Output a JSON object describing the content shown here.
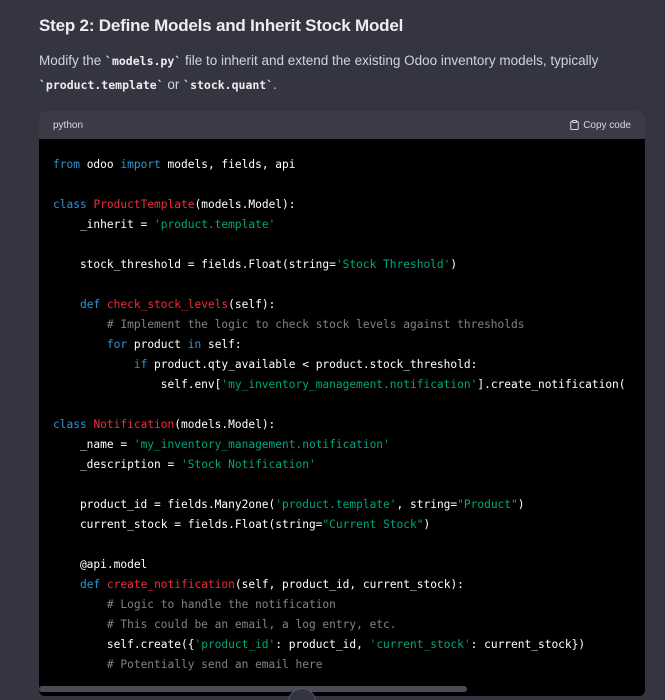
{
  "heading": "Step 2: Define Models and Inherit Stock Model",
  "paragraph": {
    "part1": "Modify the ",
    "code1": "`models.py`",
    "part2": " file to inherit and extend the existing Odoo inventory models, typically ",
    "code2": "`product.template`",
    "part3": " or ",
    "code3": "`stock.quant`",
    "part4": "."
  },
  "code_block": {
    "language": "python",
    "copy_label": "Copy code",
    "copy_icon": "clipboard-icon",
    "lines": [
      [
        [
          "kw",
          "from"
        ],
        [
          "plain",
          " odoo "
        ],
        [
          "kw",
          "import"
        ],
        [
          "plain",
          " models, fields, api"
        ]
      ],
      [],
      [
        [
          "kw",
          "class"
        ],
        [
          "plain",
          " "
        ],
        [
          "cls",
          "ProductTemplate"
        ],
        [
          "plain",
          "(models.Model):"
        ]
      ],
      [
        [
          "plain",
          "    _inherit = "
        ],
        [
          "str",
          "'product.template'"
        ]
      ],
      [],
      [
        [
          "plain",
          "    stock_threshold = fields.Float(string="
        ],
        [
          "str",
          "'Stock Threshold'"
        ],
        [
          "plain",
          ")"
        ]
      ],
      [],
      [
        [
          "plain",
          "    "
        ],
        [
          "kw",
          "def"
        ],
        [
          "plain",
          " "
        ],
        [
          "cls",
          "check_stock_levels"
        ],
        [
          "plain",
          "(self):"
        ]
      ],
      [
        [
          "plain",
          "        "
        ],
        [
          "cmt",
          "# Implement the logic to check stock levels against thresholds"
        ]
      ],
      [
        [
          "plain",
          "        "
        ],
        [
          "kw",
          "for"
        ],
        [
          "plain",
          " product "
        ],
        [
          "kw",
          "in"
        ],
        [
          "plain",
          " self:"
        ]
      ],
      [
        [
          "plain",
          "            "
        ],
        [
          "kw",
          "if"
        ],
        [
          "plain",
          " product.qty_available < product.stock_threshold:"
        ]
      ],
      [
        [
          "plain",
          "                self.env["
        ],
        [
          "str",
          "'my_inventory_management.notification'"
        ],
        [
          "plain",
          "].create_notification("
        ]
      ],
      [],
      [
        [
          "kw",
          "class"
        ],
        [
          "plain",
          " "
        ],
        [
          "cls",
          "Notification"
        ],
        [
          "plain",
          "(models.Model):"
        ]
      ],
      [
        [
          "plain",
          "    _name = "
        ],
        [
          "str",
          "'my_inventory_management.notification'"
        ]
      ],
      [
        [
          "plain",
          "    _description = "
        ],
        [
          "str",
          "'Stock Notification'"
        ]
      ],
      [],
      [
        [
          "plain",
          "    product_id = fields.Many2one("
        ],
        [
          "str",
          "'product.template'"
        ],
        [
          "plain",
          ", string="
        ],
        [
          "str",
          "\"Product\""
        ],
        [
          "plain",
          ")"
        ]
      ],
      [
        [
          "plain",
          "    current_stock = fields.Float(string="
        ],
        [
          "str",
          "\"Current Stock\""
        ],
        [
          "plain",
          ")"
        ]
      ],
      [],
      [
        [
          "plain",
          "    @api.model"
        ]
      ],
      [
        [
          "plain",
          "    "
        ],
        [
          "kw",
          "def"
        ],
        [
          "plain",
          " "
        ],
        [
          "cls",
          "create_notification"
        ],
        [
          "plain",
          "(self, product_id, current_stock):"
        ]
      ],
      [
        [
          "plain",
          "        "
        ],
        [
          "cmt",
          "# Logic to handle the notification"
        ]
      ],
      [
        [
          "plain",
          "        "
        ],
        [
          "cmt",
          "# This could be an email, a log entry, etc."
        ]
      ],
      [
        [
          "plain",
          "        self.create({"
        ],
        [
          "str",
          "'product_id'"
        ],
        [
          "plain",
          ": product_id, "
        ],
        [
          "str",
          "'current_stock'"
        ],
        [
          "plain",
          ": current_stock})"
        ]
      ],
      [
        [
          "plain",
          "        "
        ],
        [
          "cmt",
          "# Potentially send an email here"
        ]
      ]
    ]
  },
  "colors": {
    "page_background": "#343541",
    "code_background": "#000000",
    "keyword": "#2e95d3",
    "class_name": "#f22c3d",
    "string": "#00a67d",
    "comment": "#808080"
  }
}
